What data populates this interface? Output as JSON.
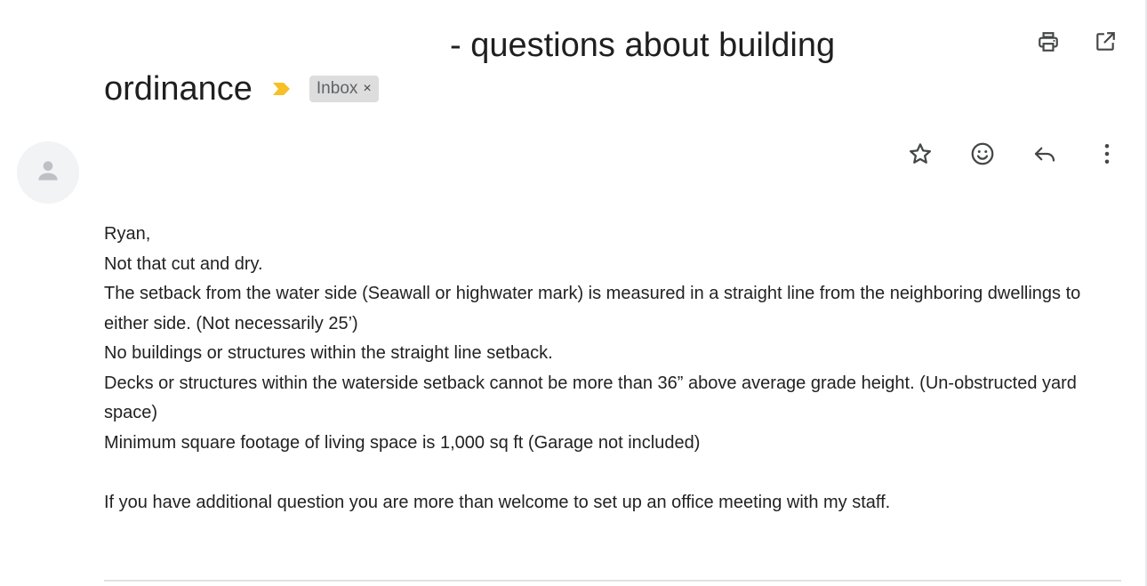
{
  "subject": {
    "line1": "- questions about building",
    "line2": "ordinance",
    "label": "Inbox",
    "label_remove": "×"
  },
  "icons": {
    "print": "print-icon",
    "open_new_window": "open-in-new-window-icon",
    "importance": "importance-marker-icon",
    "star": "star-icon",
    "emoji": "emoji-reaction-icon",
    "reply": "reply-icon",
    "more": "more-vertical-icon",
    "avatar": "default-avatar-icon"
  },
  "colors": {
    "importance": "#f6c026",
    "icon": "#444746",
    "avatar_bg": "#f1f3f4",
    "avatar_fg": "#bdc1c6",
    "chip_bg": "#dddddd"
  },
  "message": {
    "lines": [
      "Ryan,",
      "Not that cut and dry.",
      "The setback from the water side (Seawall or highwater mark) is measured in a straight line from the neighboring dwellings to either side. (Not necessarily 25’)",
      "No buildings or structures within the straight line setback.",
      "Decks or structures within the waterside setback cannot be more than 36” above average grade height. (Un-obstructed yard space)",
      "Minimum square footage of living space is 1,000 sq ft (Garage not included)"
    ],
    "closing": "If you have additional question you are more than welcome to set up an office meeting with my staff."
  }
}
